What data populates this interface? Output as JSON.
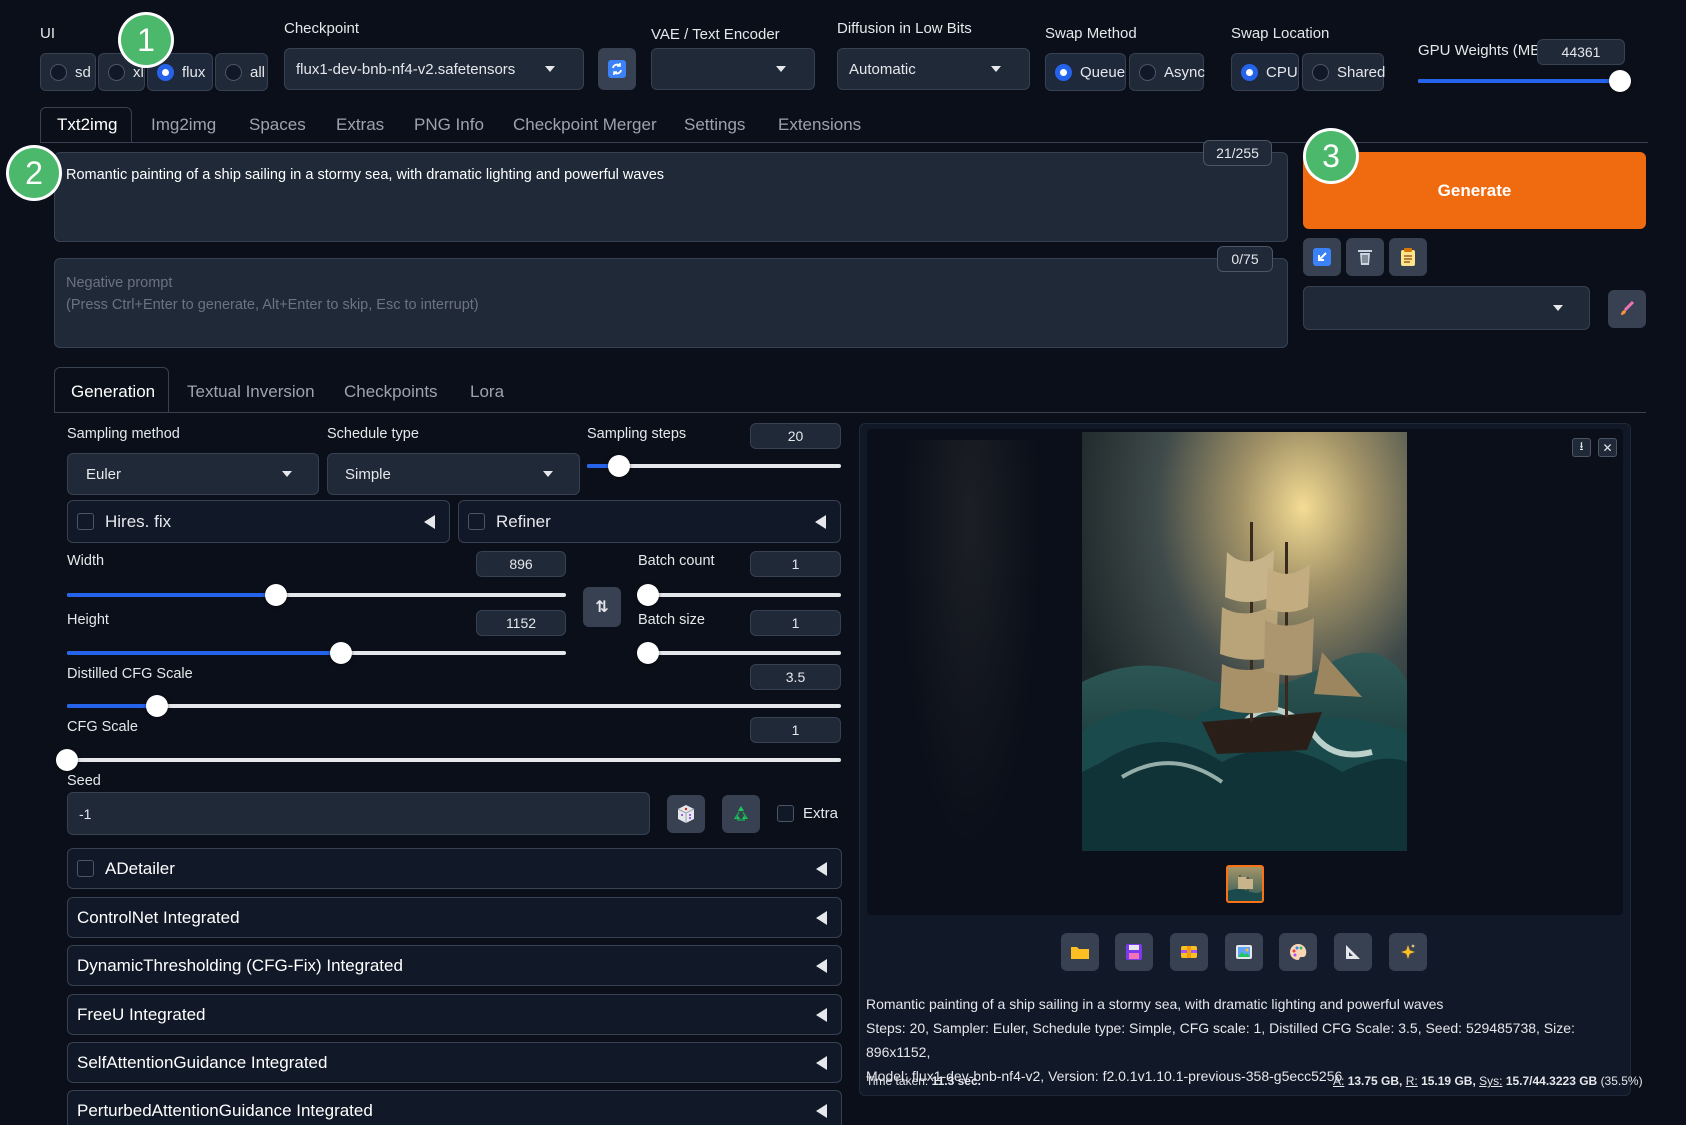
{
  "top": {
    "ui_label": "UI",
    "ui_options": [
      "sd",
      "xl",
      "flux",
      "all"
    ],
    "checkpoint_label": "Checkpoint",
    "checkpoint_value": "flux1-dev-bnb-nf4-v2.safetensors",
    "vae_label": "VAE / Text Encoder",
    "vae_value": "",
    "diffusion_label": "Diffusion in Low Bits",
    "diffusion_value": "Automatic",
    "swap_method_label": "Swap Method",
    "swap_method_options": [
      "Queue",
      "Async"
    ],
    "swap_location_label": "Swap Location",
    "swap_location_options": [
      "CPU",
      "Shared"
    ],
    "gpu_weights_label": "GPU Weights (MB)",
    "gpu_weights_value": "44361",
    "gpu_weights_fraction": 0.98
  },
  "tabs": [
    "Txt2img",
    "Img2img",
    "Spaces",
    "Extras",
    "PNG Info",
    "Checkpoint Merger",
    "Settings",
    "Extensions"
  ],
  "prompt": {
    "text": "Romantic painting of a ship sailing in a stormy sea, with dramatic lighting and powerful waves",
    "token_count": "21/255",
    "negative_placeholder_1": "Negative prompt",
    "negative_placeholder_2": "(Press Ctrl+Enter to generate, Alt+Enter to skip, Esc to interrupt)",
    "negative_count": "0/75"
  },
  "generate_label": "Generate",
  "subtabs": [
    "Generation",
    "Textual Inversion",
    "Checkpoints",
    "Lora"
  ],
  "gen": {
    "sampling_method_label": "Sampling method",
    "sampling_method_value": "Euler",
    "schedule_type_label": "Schedule type",
    "schedule_type_value": "Simple",
    "sampling_steps_label": "Sampling steps",
    "sampling_steps_value": "20",
    "hires_label": "Hires. fix",
    "refiner_label": "Refiner",
    "width_label": "Width",
    "width_value": "896",
    "height_label": "Height",
    "height_value": "1152",
    "batch_count_label": "Batch count",
    "batch_count_value": "1",
    "batch_size_label": "Batch size",
    "batch_size_value": "1",
    "distilled_cfg_label": "Distilled CFG Scale",
    "distilled_cfg_value": "3.5",
    "cfg_label": "CFG Scale",
    "cfg_value": "1",
    "seed_label": "Seed",
    "seed_value": "-1",
    "extra_label": "Extra"
  },
  "accordions": [
    "ADetailer",
    "ControlNet Integrated",
    "DynamicThresholding (CFG-Fix) Integrated",
    "FreeU Integrated",
    "SelfAttentionGuidance Integrated",
    "PerturbedAttentionGuidance Integrated"
  ],
  "output": {
    "info_line1": "Romantic painting of a ship sailing in a stormy sea, with dramatic lighting and powerful waves",
    "info_line2": "Steps: 20, Sampler: Euler, Schedule type: Simple, CFG scale: 1, Distilled CFG Scale: 3.5, Seed: 529485738, Size: 896x1152,",
    "info_line3": "Model: flux1-dev-bnb-nf4-v2, Version: f2.0.1v1.10.1-previous-358-g5ecc5256",
    "time_label": "Time taken:",
    "time_value": "11.3 sec.",
    "mem_a_label": "A:",
    "mem_a": "13.75 GB,",
    "mem_r_label": "R:",
    "mem_r": "15.19 GB,",
    "mem_sys_label": "Sys:",
    "mem_sys": "15.7/44.3223 GB",
    "mem_pct": "(35.5%)"
  },
  "steps": [
    "1",
    "2",
    "3"
  ],
  "colors": {
    "accent": "#2563eb",
    "generate": "#f06a0f",
    "step": "#4cb86b"
  }
}
